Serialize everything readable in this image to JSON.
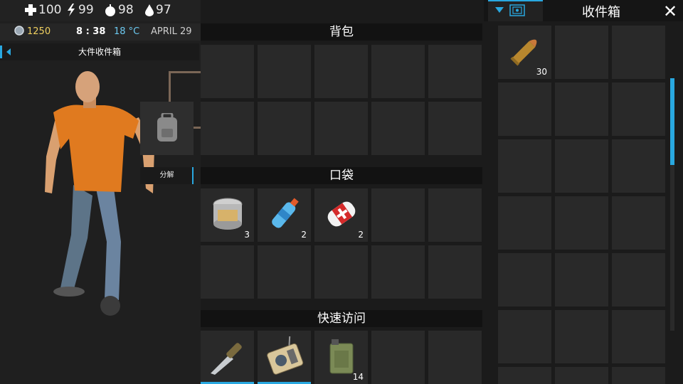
{
  "status": {
    "health": "100",
    "energy": "99",
    "food": "98",
    "water": "97"
  },
  "info": {
    "coins": "1250",
    "time": "8 : 38",
    "temperature": "18 °C",
    "date": "APRIL 29"
  },
  "left_panel": {
    "crate_tab_label": "大件收件箱",
    "decompose_label": "分解"
  },
  "backpack": {
    "title": "背包"
  },
  "pockets": {
    "title": "口袋",
    "items": [
      {
        "icon": "canned-food-icon",
        "count": "3"
      },
      {
        "icon": "water-bottle-icon",
        "count": "2"
      },
      {
        "icon": "bandage-icon",
        "count": "2"
      }
    ]
  },
  "quick_access": {
    "title": "快速访问",
    "items": [
      {
        "icon": "knife-icon",
        "count": ""
      },
      {
        "icon": "radio-icon",
        "count": ""
      },
      {
        "icon": "jerrycan-icon",
        "count": "14"
      }
    ]
  },
  "storage": {
    "title": "收件箱",
    "items": [
      {
        "icon": "bullet-icon",
        "count": "30"
      }
    ]
  },
  "colors": {
    "accent": "#29a8e0",
    "slot": "#292929",
    "connector": "#7a6656"
  }
}
